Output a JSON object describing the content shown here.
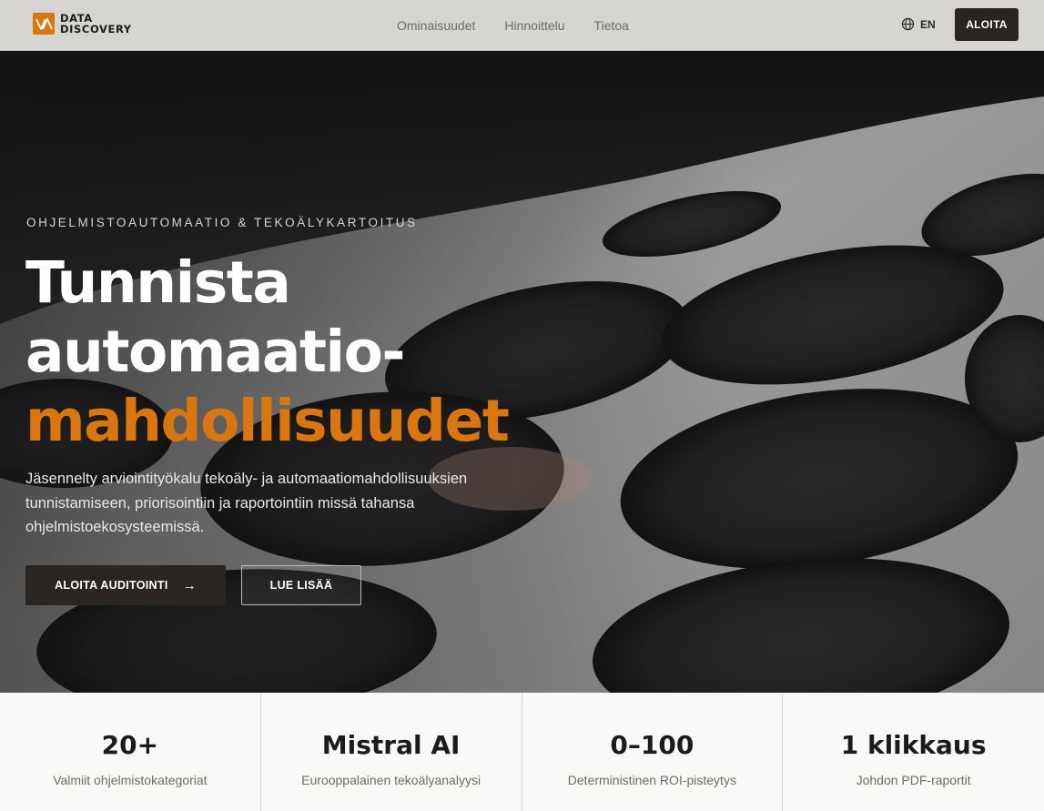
{
  "nav": {
    "logo_line1": "DATA",
    "logo_line2": "DISCOVERY",
    "links": [
      "Ominaisuudet",
      "Hinnoittelu",
      "Tietoa"
    ],
    "lang_label": "EN",
    "cta_label": "ALOITA"
  },
  "hero": {
    "eyebrow": "OHJELMISTOAUTOMAATIO & TEKOÄLYKARTOITUS",
    "headline_line1": "Tunnista",
    "headline_line2": "automaatio-",
    "headline_accent": "mahdollisuudet",
    "lead": "Jäsennelty arviointityökalu tekoäly- ja automaatiomahdollisuuksien tunnistamiseen, priorisointiin ja raportointiin missä tahansa ohjelmistoekosysteemissä.",
    "primary_button": "ALOITA AUDITOINTI",
    "secondary_button": "LUE LISÄÄ"
  },
  "stats": [
    {
      "value": "20+",
      "label": "Valmiit ohjelmistokategoriat"
    },
    {
      "value": "Mistral AI",
      "label": "Eurooppalainen tekoälyanalyysi"
    },
    {
      "value": "0–100",
      "label": "Deterministinen ROI-pisteytys"
    },
    {
      "value": "1 klikkaus",
      "label": "Johdon PDF-raportit"
    }
  ],
  "colors": {
    "accent": "#d9760f",
    "dark_button": "#2a2523",
    "nav_bg": "#d6d5d2"
  },
  "icons": {
    "logo": "logo-mark-icon",
    "language": "globe-icon",
    "primary_button": "arrow-right-icon"
  }
}
